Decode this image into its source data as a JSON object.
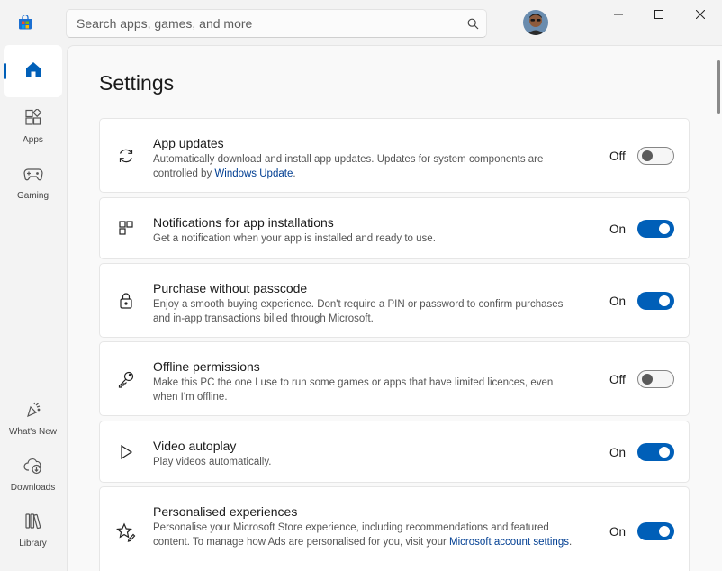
{
  "search": {
    "placeholder": "Search apps, games, and more"
  },
  "window_controls": {
    "minimize": "minimize-icon",
    "maximize": "maximize-icon",
    "close": "close-icon"
  },
  "sidebar": {
    "items": [
      {
        "label": "",
        "icon": "home-icon",
        "active": true
      },
      {
        "label": "Apps",
        "icon": "apps-icon"
      },
      {
        "label": "Gaming",
        "icon": "gamepad-icon"
      },
      {
        "label": "What's New",
        "icon": "whats-new-icon"
      },
      {
        "label": "Downloads",
        "icon": "downloads-icon"
      },
      {
        "label": "Library",
        "icon": "library-icon"
      }
    ]
  },
  "page": {
    "title": "Settings"
  },
  "settings": [
    {
      "title": "App updates",
      "desc_before": "Automatically download and install app updates. Updates for system components are controlled by ",
      "desc_link": "Windows Update",
      "desc_after": ".",
      "state": "Off",
      "on": false,
      "icon": "refresh-icon"
    },
    {
      "title": "Notifications for app installations",
      "desc": "Get a notification when your app is installed and ready to use.",
      "state": "On",
      "on": true,
      "icon": "notification-icon"
    },
    {
      "title": "Purchase without passcode",
      "desc": "Enjoy a smooth buying experience. Don't require a PIN or password to confirm purchases and in-app transactions billed through Microsoft.",
      "state": "On",
      "on": true,
      "icon": "lock-icon"
    },
    {
      "title": "Offline permissions",
      "desc": "Make this PC the one I use to run some games or apps that have limited licences, even when I'm offline.",
      "state": "Off",
      "on": false,
      "icon": "key-icon"
    },
    {
      "title": "Video autoplay",
      "desc": "Play videos automatically.",
      "state": "On",
      "on": true,
      "icon": "play-icon"
    },
    {
      "title": "Personalised experiences",
      "desc_before": "Personalise your Microsoft Store experience, including recommendations and featured content. To manage how Ads are personalised for you, visit your ",
      "desc_link": "Microsoft account settings",
      "desc_after": ".",
      "state": "On",
      "on": true,
      "icon": "personalise-icon"
    }
  ],
  "colors": {
    "accent": "#005fb8",
    "link": "#003e92"
  }
}
